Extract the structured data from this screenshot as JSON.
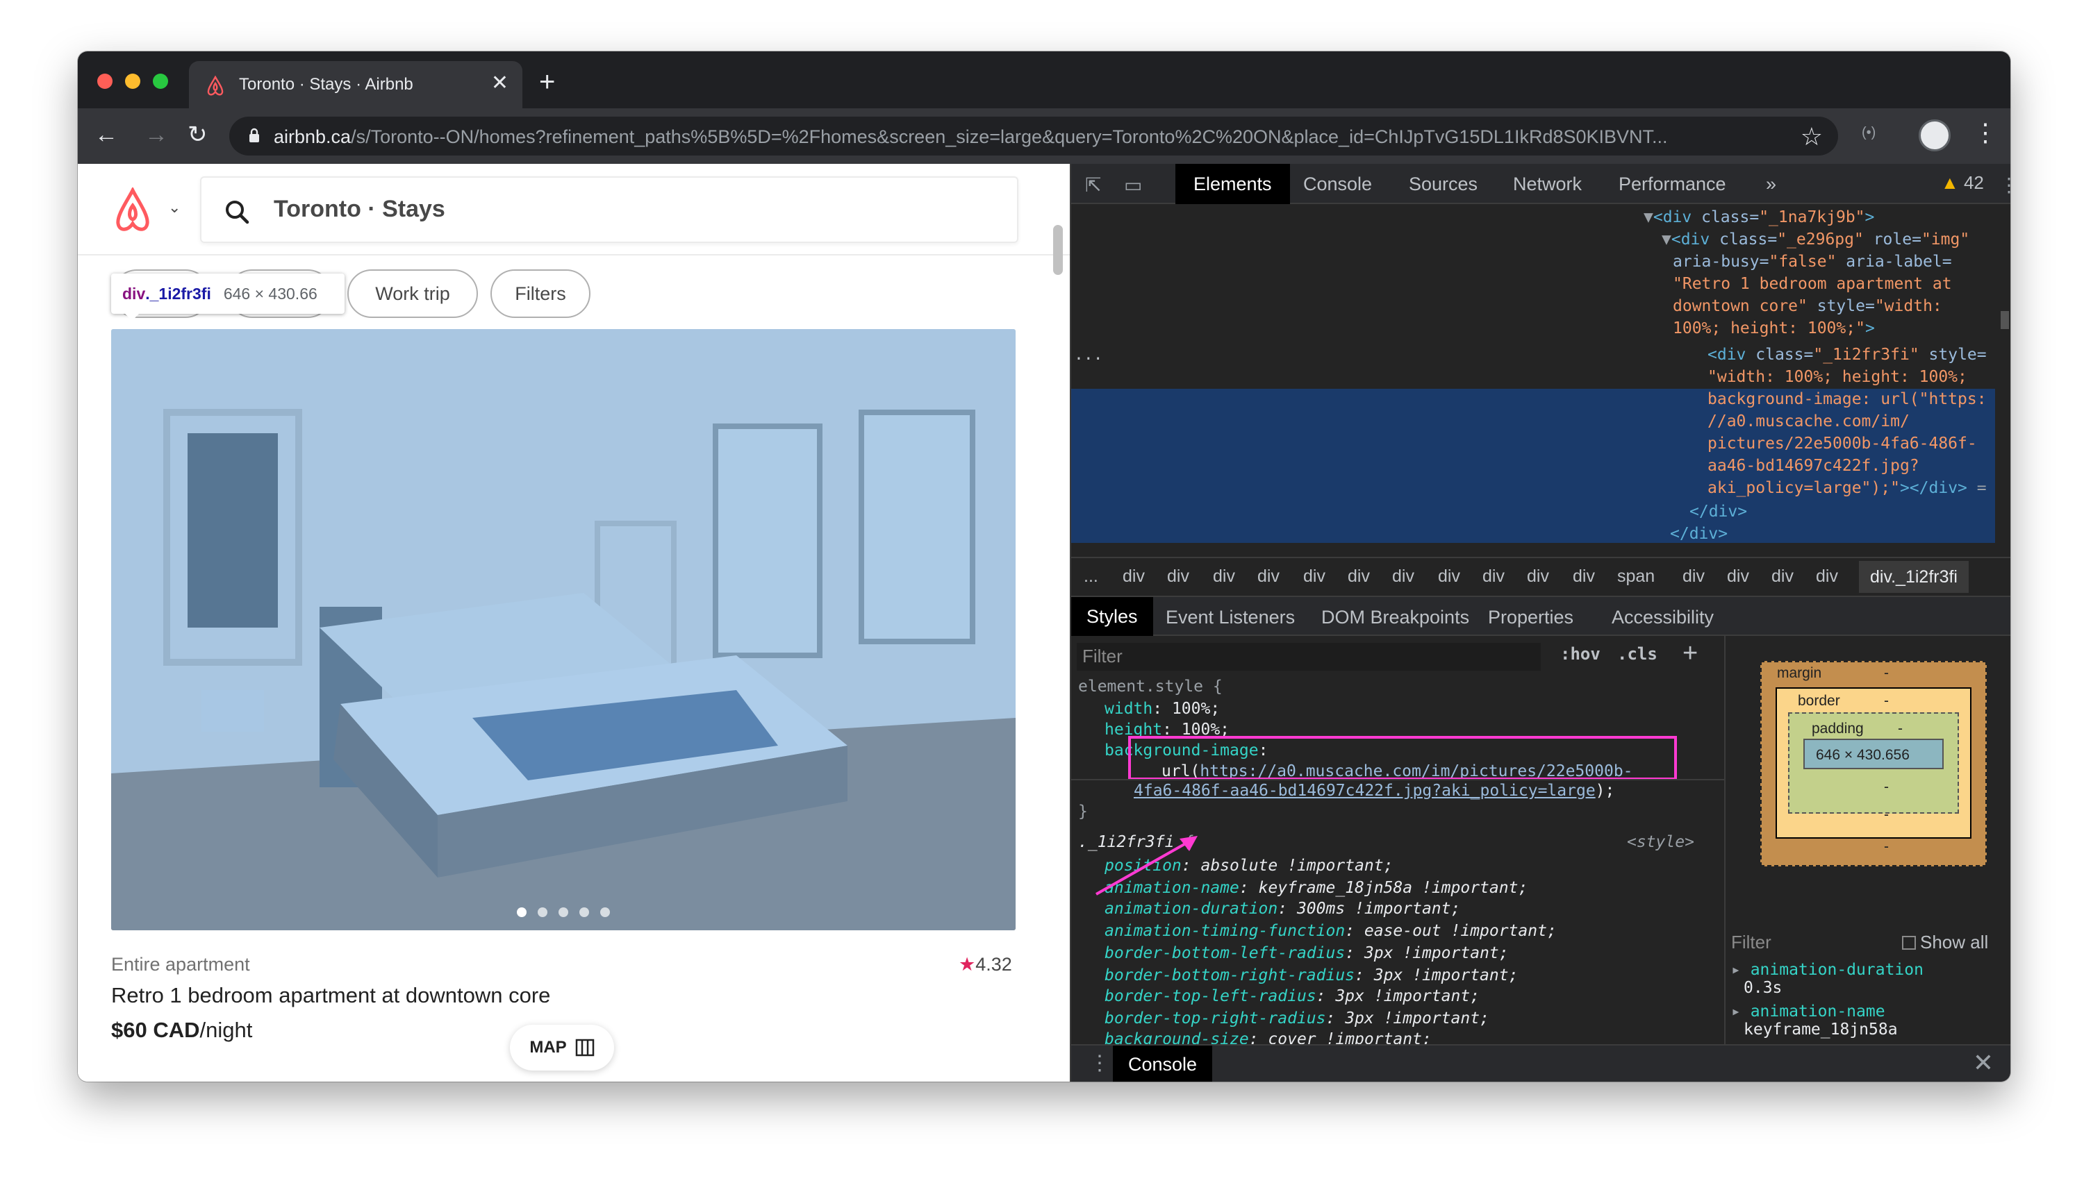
{
  "browser": {
    "tab_title": "Toronto · Stays · Airbnb",
    "tab_close": "✕",
    "new_tab": "+",
    "url_host": "airbnb.ca",
    "url_path": "/s/Toronto--ON/homes?refinement_paths%5B%5D=%2Fhomes&screen_size=large&query=Toronto%2C%20ON&place_id=ChIJpTvG15DL1IkRd8S0KIBVNT...",
    "traffic_colors": [
      "#ff5f57",
      "#febc2e",
      "#28c840"
    ]
  },
  "page": {
    "search_text": "Toronto · Stays",
    "pills": [
      "Work trip",
      "Filters"
    ],
    "tooltip": {
      "tag": "div",
      "class": "._1i2fr3fi",
      "dims": "646 × 430.66"
    },
    "listing": {
      "type": "Entire apartment",
      "rating": "4.32",
      "title": "Retro 1 bedroom apartment at downtown core",
      "price": "$60 CAD",
      "price_unit": "/night"
    },
    "map_button": "MAP",
    "brand_color": "#ff5a5f"
  },
  "devtools": {
    "tabs": [
      "Elements",
      "Console",
      "Sources",
      "Network",
      "Performance"
    ],
    "more": "»",
    "warnings": "42",
    "breadcrumbs": [
      "...",
      "div",
      "div",
      "div",
      "div",
      "div",
      "div",
      "div",
      "div",
      "div",
      "div",
      "div",
      "span",
      "div",
      "div",
      "div",
      "div",
      "div._1i2fr3fi"
    ],
    "subtabs": [
      "Styles",
      "Event Listeners",
      "DOM Breakpoints",
      "Properties",
      "Accessibility"
    ],
    "filter_placeholder": "Filter",
    "hov": ":hov",
    "cls": ".cls",
    "plus": "+",
    "computed_filter": "Filter",
    "show_all": "Show all",
    "computed": [
      {
        "prop": "animation-duration",
        "value": "0.3s"
      },
      {
        "prop": "animation-name",
        "value": "keyframe_18jn58a"
      }
    ],
    "box_model": {
      "margin": "margin",
      "border": "border",
      "padding": "padding",
      "content": "646 × 430.656",
      "dash": "-"
    },
    "drawer_tab": "Console"
  }
}
